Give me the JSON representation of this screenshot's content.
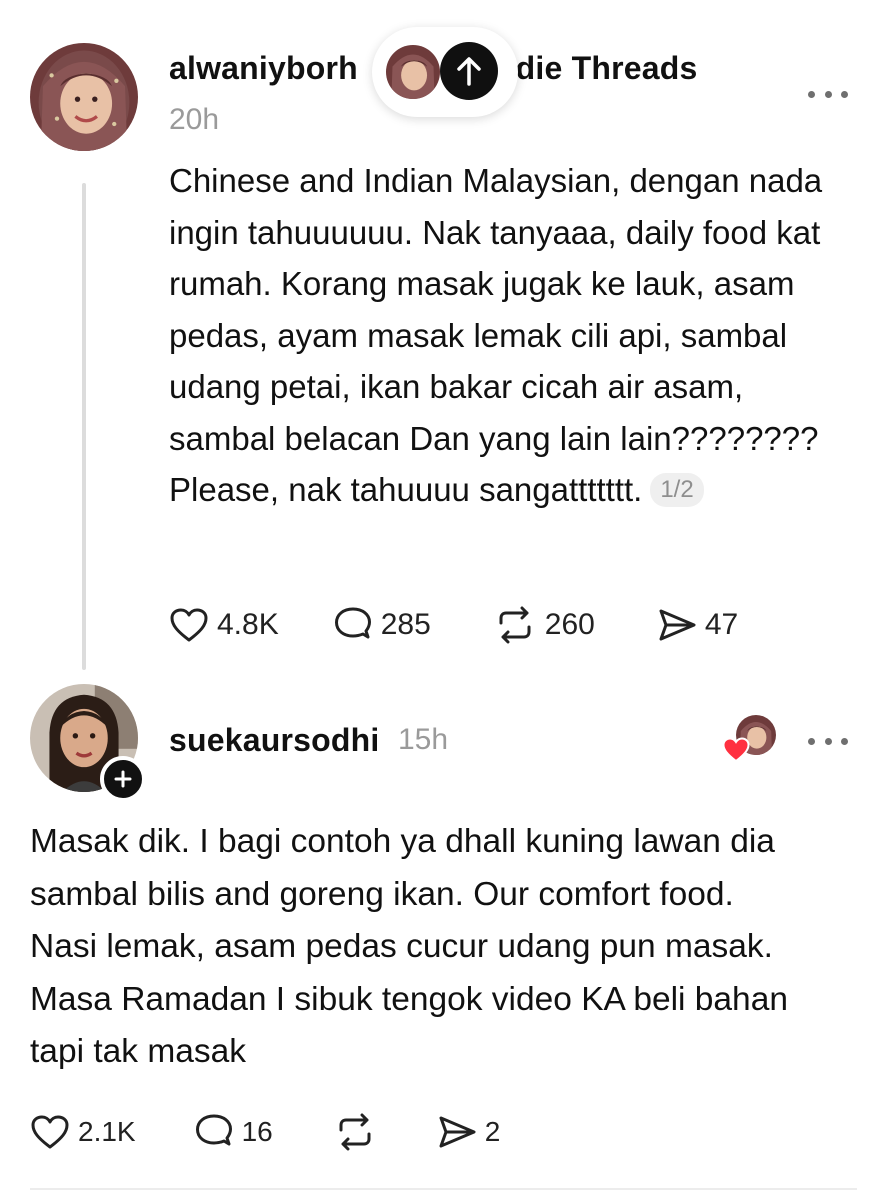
{
  "post": {
    "username": "alwaniyborh",
    "username_suffix": "odie Threads",
    "time": "20h",
    "text": "Chinese and Indian Malaysian, dengan nada ingin tahuuuuuu. Nak tanyaaa, daily food kat rumah. Korang masak jugak ke lauk, asam pedas, ayam masak lemak cili api, sambal udang petai, ikan bakar cicah air asam, sambal belacan Dan yang lain lain???????? Please, nak tahuuuu sangattttttt.",
    "page_indicator": "1/2",
    "likes": "4.8K",
    "replies": "285",
    "reposts": "260",
    "shares": "47"
  },
  "reply": {
    "username": "suekaursodhi",
    "time": "15h",
    "text": "Masak dik. I bagi contoh ya dhall kuning lawan dia sambal bilis and goreng ikan. Our comfort food. Nasi lemak, asam pedas cucur udang pun masak. Masa Ramadan I sibuk tengok video KA beli bahan tapi tak masak",
    "likes": "2.1K",
    "replies": "16",
    "shares": "2"
  },
  "icons": {
    "like": "heart-icon",
    "reply": "comment-icon",
    "repost": "repost-icon",
    "share": "send-icon",
    "more": "more-dots-icon",
    "scroll_top": "arrow-up-icon",
    "follow": "plus-icon"
  },
  "colors": {
    "text": "#111111",
    "muted": "#9a9a9a",
    "liked_heart": "#ff3040"
  }
}
